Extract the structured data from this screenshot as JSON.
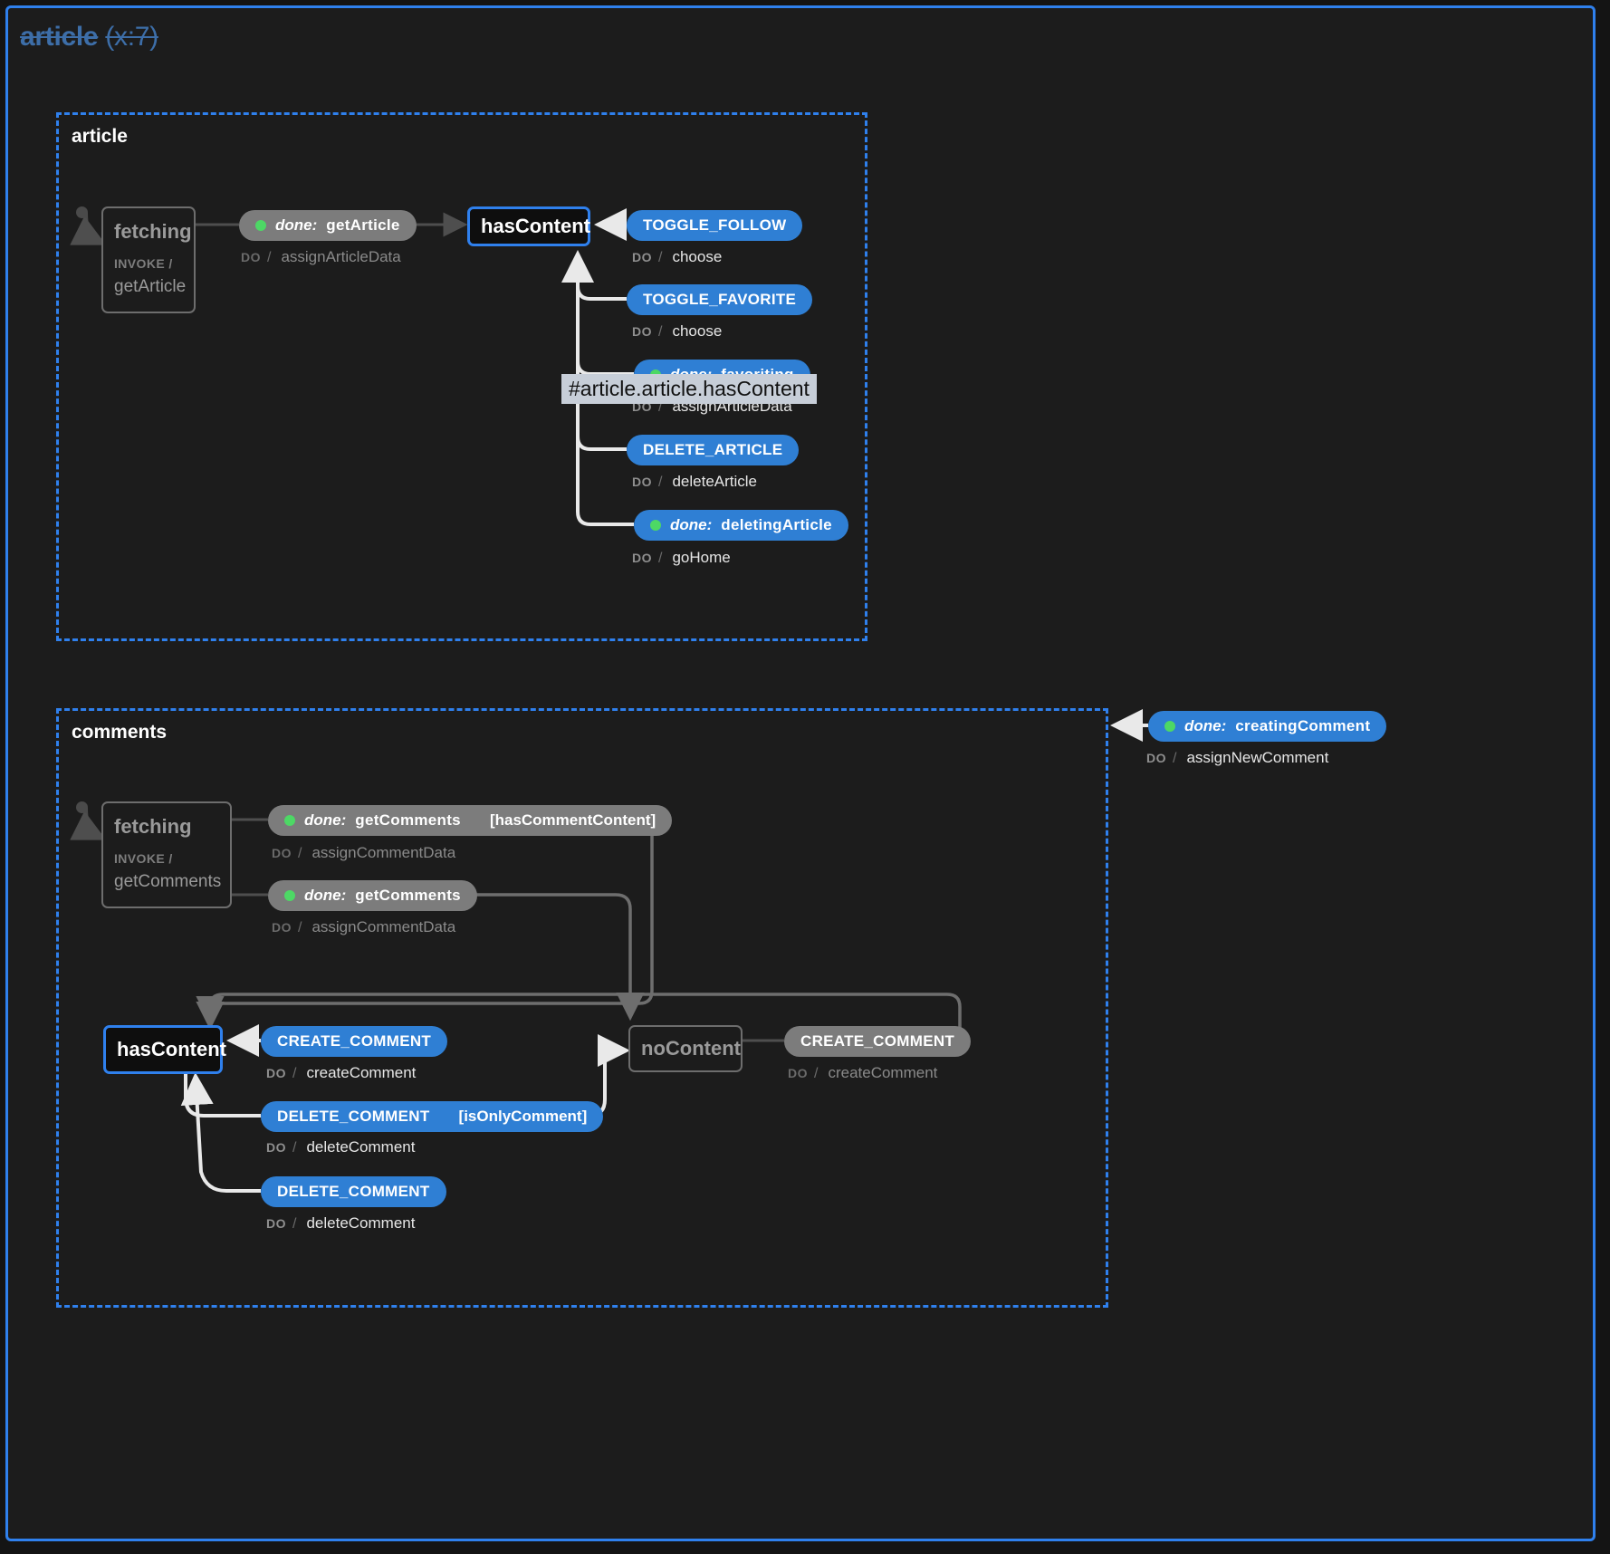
{
  "machine": {
    "title": "article",
    "count": "(x:7)"
  },
  "tooltip": {
    "text": "#article.article.hasContent"
  },
  "regions": [
    {
      "id": "article",
      "title": "article"
    },
    {
      "id": "comments",
      "title": "comments"
    }
  ],
  "article_region": {
    "states": [
      {
        "name": "fetching",
        "invoke_kw": "INVOKE /",
        "invoke_src": "getArticle",
        "active": false
      },
      {
        "name": "hasContent",
        "active": true
      }
    ],
    "transitions": [
      {
        "done_kw": "done:",
        "label": "getArticle",
        "style": "gray",
        "has_dot": true,
        "guard": "",
        "action_kw": "DO",
        "action_slash": "/",
        "action": "assignArticleData",
        "dim": true
      },
      {
        "done_kw": "",
        "label": "TOGGLE_FOLLOW",
        "style": "blue",
        "has_dot": false,
        "guard": "",
        "action_kw": "DO",
        "action_slash": "/",
        "action": "choose",
        "dim": false
      },
      {
        "done_kw": "",
        "label": "TOGGLE_FAVORITE",
        "style": "blue",
        "has_dot": false,
        "guard": "",
        "action_kw": "DO",
        "action_slash": "/",
        "action": "choose",
        "dim": false
      },
      {
        "done_kw": "done:",
        "label": "favoriting",
        "style": "blue",
        "has_dot": true,
        "guard": "",
        "action_kw": "DO",
        "action_slash": "/",
        "action": "assignArticleData",
        "dim": false
      },
      {
        "done_kw": "",
        "label": "DELETE_ARTICLE",
        "style": "blue",
        "has_dot": false,
        "guard": "",
        "action_kw": "DO",
        "action_slash": "/",
        "action": "deleteArticle",
        "dim": false
      },
      {
        "done_kw": "done:",
        "label": "deletingArticle",
        "style": "blue",
        "has_dot": true,
        "guard": "",
        "action_kw": "DO",
        "action_slash": "/",
        "action": "goHome",
        "dim": false
      }
    ]
  },
  "comments_region": {
    "external_transition": {
      "done_kw": "done:",
      "label": "creatingComment",
      "style": "blue",
      "has_dot": true,
      "action_kw": "DO",
      "action_slash": "/",
      "action": "assignNewComment"
    },
    "states": [
      {
        "name": "fetching",
        "invoke_kw": "INVOKE /",
        "invoke_src": "getComments",
        "active": false
      },
      {
        "name": "hasContent",
        "active": true
      },
      {
        "name": "noContent",
        "active": false
      }
    ],
    "transitions": [
      {
        "done_kw": "done:",
        "label": "getComments",
        "style": "gray",
        "has_dot": true,
        "guard": "[hasCommentContent]",
        "action_kw": "DO",
        "action_slash": "/",
        "action": "assignCommentData",
        "dim": true
      },
      {
        "done_kw": "done:",
        "label": "getComments",
        "style": "gray",
        "has_dot": true,
        "guard": "",
        "action_kw": "DO",
        "action_slash": "/",
        "action": "assignCommentData",
        "dim": true
      },
      {
        "done_kw": "",
        "label": "CREATE_COMMENT",
        "style": "blue",
        "has_dot": false,
        "guard": "",
        "action_kw": "DO",
        "action_slash": "/",
        "action": "createComment",
        "dim": false
      },
      {
        "done_kw": "",
        "label": "DELETE_COMMENT",
        "style": "blue",
        "has_dot": false,
        "guard": "[isOnlyComment]",
        "action_kw": "DO",
        "action_slash": "/",
        "action": "deleteComment",
        "dim": false
      },
      {
        "done_kw": "",
        "label": "DELETE_COMMENT",
        "style": "blue",
        "has_dot": false,
        "guard": "",
        "action_kw": "DO",
        "action_slash": "/",
        "action": "deleteComment",
        "dim": false
      },
      {
        "done_kw": "",
        "label": "CREATE_COMMENT",
        "style": "gray",
        "has_dot": false,
        "guard": "",
        "action_kw": "DO",
        "action_slash": "/",
        "action": "createComment",
        "dim": true
      }
    ]
  },
  "colors": {
    "accent": "#2f80ed",
    "event_blue": "#2f7fd4",
    "event_gray": "#7c7c7c",
    "done_dot": "#4dd865",
    "background": "#141414",
    "panel": "#1c1c1c",
    "title": "#3d6ea8"
  }
}
